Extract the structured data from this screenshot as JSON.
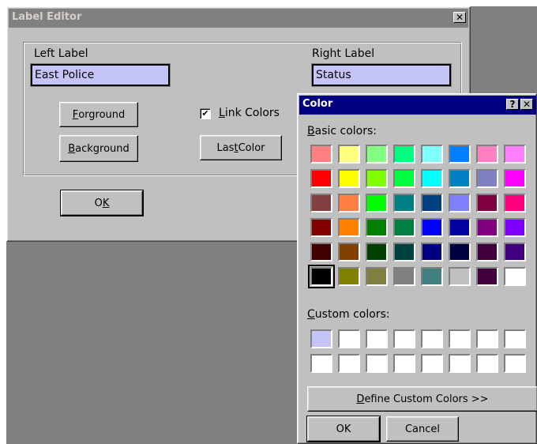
{
  "label_editor": {
    "title": "Label Editor",
    "close_glyph": "✕",
    "left_label_caption": "Left Label",
    "left_label_value": "East Police",
    "right_label_caption": "Right Label",
    "right_label_value": "Status",
    "foreground_mnemonic": "F",
    "foreground_rest": "orground",
    "background_mnemonic": "B",
    "background_rest": "ackground",
    "link_colors_mnemonic": "L",
    "link_colors_rest": "ink Colors",
    "link_colors_checked": true,
    "check_glyph": "✔",
    "last_color_pre": "Las",
    "last_color_mnemonic": "t",
    "last_color_post": " Color",
    "ok_pre": "O",
    "ok_mnemonic": "K",
    "input_color": "#c4c4f8"
  },
  "color_dialog": {
    "title": "Color",
    "help_glyph": "?",
    "close_glyph": "✕",
    "basic_mnemonic": "B",
    "basic_rest": "asic colors:",
    "custom_mnemonic": "C",
    "custom_rest": "ustom colors:",
    "define_mnemonic": "D",
    "define_rest": "efine Custom Colors >>",
    "ok_label": "OK",
    "cancel_label": "Cancel",
    "selected_basic_index": 40,
    "basic_colors": [
      "#ff8080",
      "#ffff80",
      "#80ff80",
      "#00ff80",
      "#80ffff",
      "#0080ff",
      "#ff80c0",
      "#ff80ff",
      "#ff0000",
      "#ffff00",
      "#80ff00",
      "#00ff40",
      "#00ffff",
      "#0080c0",
      "#8080c0",
      "#ff00ff",
      "#804040",
      "#ff8040",
      "#00ff00",
      "#008080",
      "#004080",
      "#8080ff",
      "#800040",
      "#ff0080",
      "#800000",
      "#ff8000",
      "#008000",
      "#008040",
      "#0000ff",
      "#0000a0",
      "#800080",
      "#8000ff",
      "#400000",
      "#804000",
      "#004000",
      "#004040",
      "#000080",
      "#000040",
      "#400040",
      "#400080",
      "#000000",
      "#808000",
      "#808040",
      "#808080",
      "#408080",
      "#c0c0c0",
      "#400040",
      "#ffffff"
    ],
    "custom_colors": [
      "#c4c4f8",
      "#ffffff",
      "#ffffff",
      "#ffffff",
      "#ffffff",
      "#ffffff",
      "#ffffff",
      "#ffffff",
      "#ffffff",
      "#ffffff",
      "#ffffff",
      "#ffffff",
      "#ffffff",
      "#ffffff",
      "#ffffff",
      "#ffffff"
    ]
  }
}
